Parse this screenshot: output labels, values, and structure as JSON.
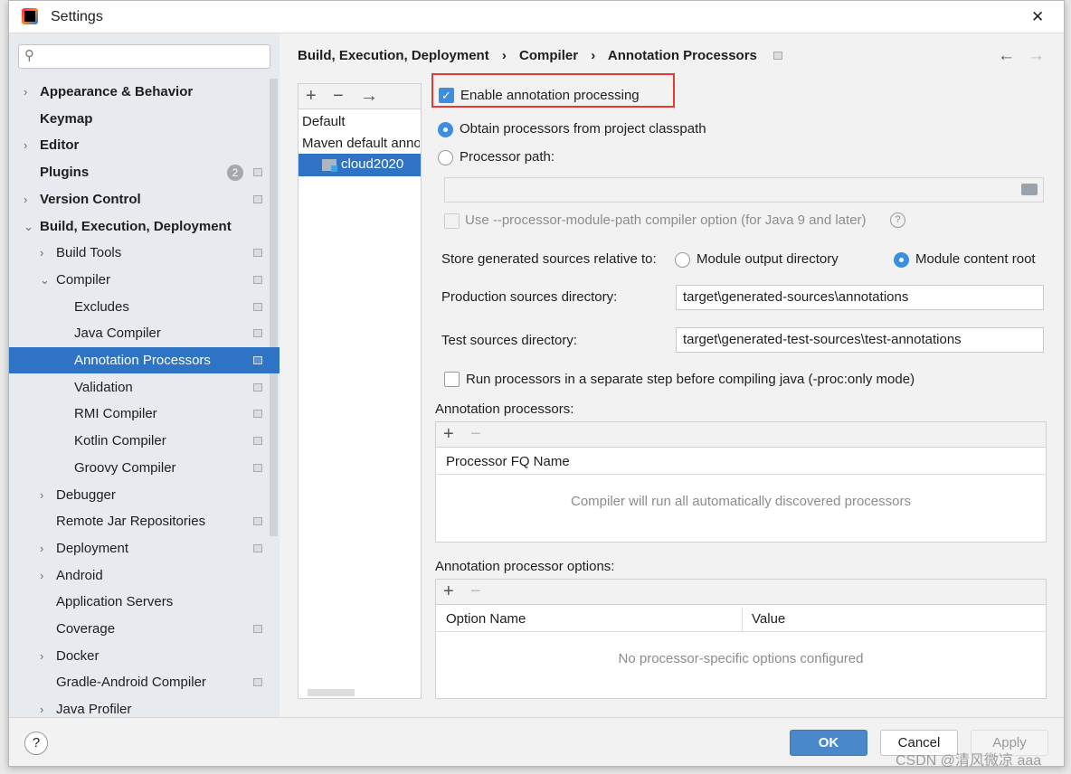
{
  "window": {
    "title": "Settings",
    "close": "✕"
  },
  "search": {
    "placeholder": ""
  },
  "sidebar": {
    "items": [
      {
        "label": "Appearance & Behavior",
        "level": 0,
        "bold": true,
        "chevron": "›"
      },
      {
        "label": "Keymap",
        "level": 0,
        "bold": true
      },
      {
        "label": "Editor",
        "level": 0,
        "bold": true,
        "chevron": "›"
      },
      {
        "label": "Plugins",
        "level": 0,
        "bold": true,
        "badge": "2",
        "mark": true
      },
      {
        "label": "Version Control",
        "level": 0,
        "bold": true,
        "chevron": "›",
        "mark": true
      },
      {
        "label": "Build, Execution, Deployment",
        "level": 0,
        "bold": true,
        "chevron": "⌄"
      },
      {
        "label": "Build Tools",
        "level": 1,
        "chevron": "›",
        "mark": true
      },
      {
        "label": "Compiler",
        "level": 1,
        "chevron": "⌄",
        "mark": true
      },
      {
        "label": "Excludes",
        "level": 2,
        "mark": true
      },
      {
        "label": "Java Compiler",
        "level": 2,
        "mark": true
      },
      {
        "label": "Annotation Processors",
        "level": 2,
        "mark": true,
        "selected": true
      },
      {
        "label": "Validation",
        "level": 2,
        "mark": true
      },
      {
        "label": "RMI Compiler",
        "level": 2,
        "mark": true
      },
      {
        "label": "Kotlin Compiler",
        "level": 2,
        "mark": true
      },
      {
        "label": "Groovy Compiler",
        "level": 2,
        "mark": true
      },
      {
        "label": "Debugger",
        "level": 1,
        "chevron": "›"
      },
      {
        "label": "Remote Jar Repositories",
        "level": 1,
        "mark": true
      },
      {
        "label": "Deployment",
        "level": 1,
        "chevron": "›",
        "mark": true
      },
      {
        "label": "Android",
        "level": 1,
        "chevron": "›"
      },
      {
        "label": "Application Servers",
        "level": 1
      },
      {
        "label": "Coverage",
        "level": 1,
        "mark": true
      },
      {
        "label": "Docker",
        "level": 1,
        "chevron": "›"
      },
      {
        "label": "Gradle-Android Compiler",
        "level": 1,
        "mark": true
      },
      {
        "label": "Java Profiler",
        "level": 1,
        "chevron": "›"
      }
    ]
  },
  "breadcrumb": {
    "items": [
      "Build, Execution, Deployment",
      "Compiler",
      "Annotation Processors"
    ],
    "sep": "›",
    "back": "←",
    "forward": "→"
  },
  "profiles": {
    "add": "+",
    "remove": "−",
    "move": "→",
    "items": [
      "Default",
      "Maven default annotation processors profile"
    ],
    "selected": "cloud2020"
  },
  "settings": {
    "enable": {
      "label": "Enable annotation processing",
      "checked": true
    },
    "obtain_classpath": {
      "label": "Obtain processors from project classpath",
      "selected": true
    },
    "processor_path": {
      "label": "Processor path:",
      "value": ""
    },
    "module_path": {
      "label": "Use --processor-module-path compiler option (for Java 9 and later)",
      "help": "?",
      "checked": false
    },
    "store_label": "Store generated sources relative to:",
    "module_output": "Module output directory",
    "module_content": "Module content root",
    "prod_label": "Production sources directory:",
    "prod_value": "target\\generated-sources\\annotations",
    "test_label": "Test sources directory:",
    "test_value": "target\\generated-test-sources\\test-annotations",
    "run_separate": {
      "label": "Run processors in a separate step before compiling java (-proc:only mode)",
      "checked": false
    }
  },
  "processors": {
    "title": "Annotation processors:",
    "add": "+",
    "remove": "−",
    "column": "Processor FQ Name",
    "empty": "Compiler will run all automatically discovered processors"
  },
  "options": {
    "title": "Annotation processor options:",
    "add": "+",
    "remove": "−",
    "columns": [
      "Option Name",
      "Value"
    ],
    "empty": "No processor-specific options configured"
  },
  "footer": {
    "help": "?",
    "ok": "OK",
    "cancel": "Cancel",
    "apply": "Apply"
  },
  "watermark": "CSDN @清风微凉 aaa",
  "colors": {
    "accent": "#2f73c4",
    "highlight_box": "#e53935",
    "ok_button": "#4a88cc"
  }
}
